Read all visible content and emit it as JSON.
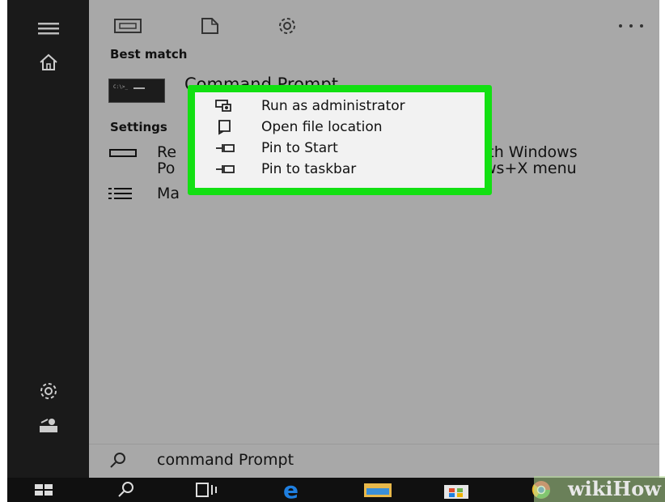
{
  "start": {
    "best_match_heading": "Best match",
    "best_match_title": "Command Prompt",
    "settings_heading": "Settings",
    "settings_items": [
      {
        "line1_left": "Re",
        "line1_right": "ith Windows",
        "line2_left": "Po",
        "line2_right": "ws+X menu"
      },
      {
        "line1_left": "Ma"
      }
    ]
  },
  "search": {
    "query": "command Prompt"
  },
  "context_menu": {
    "items": [
      {
        "label": "Run as administrator",
        "icon": "run-as-admin-icon"
      },
      {
        "label": "Open file location",
        "icon": "folder-location-icon"
      },
      {
        "label": "Pin to Start",
        "icon": "pin-icon"
      },
      {
        "label": "Pin to taskbar",
        "icon": "pin-icon"
      }
    ],
    "highlight_color": "#12e012"
  },
  "watermark": {
    "text": "wikiHow"
  },
  "colors": {
    "panel": "#a8a8a8",
    "rail": "#1a1a1a",
    "taskbar": "#101010",
    "edge_blue": "#1f7fe0"
  }
}
